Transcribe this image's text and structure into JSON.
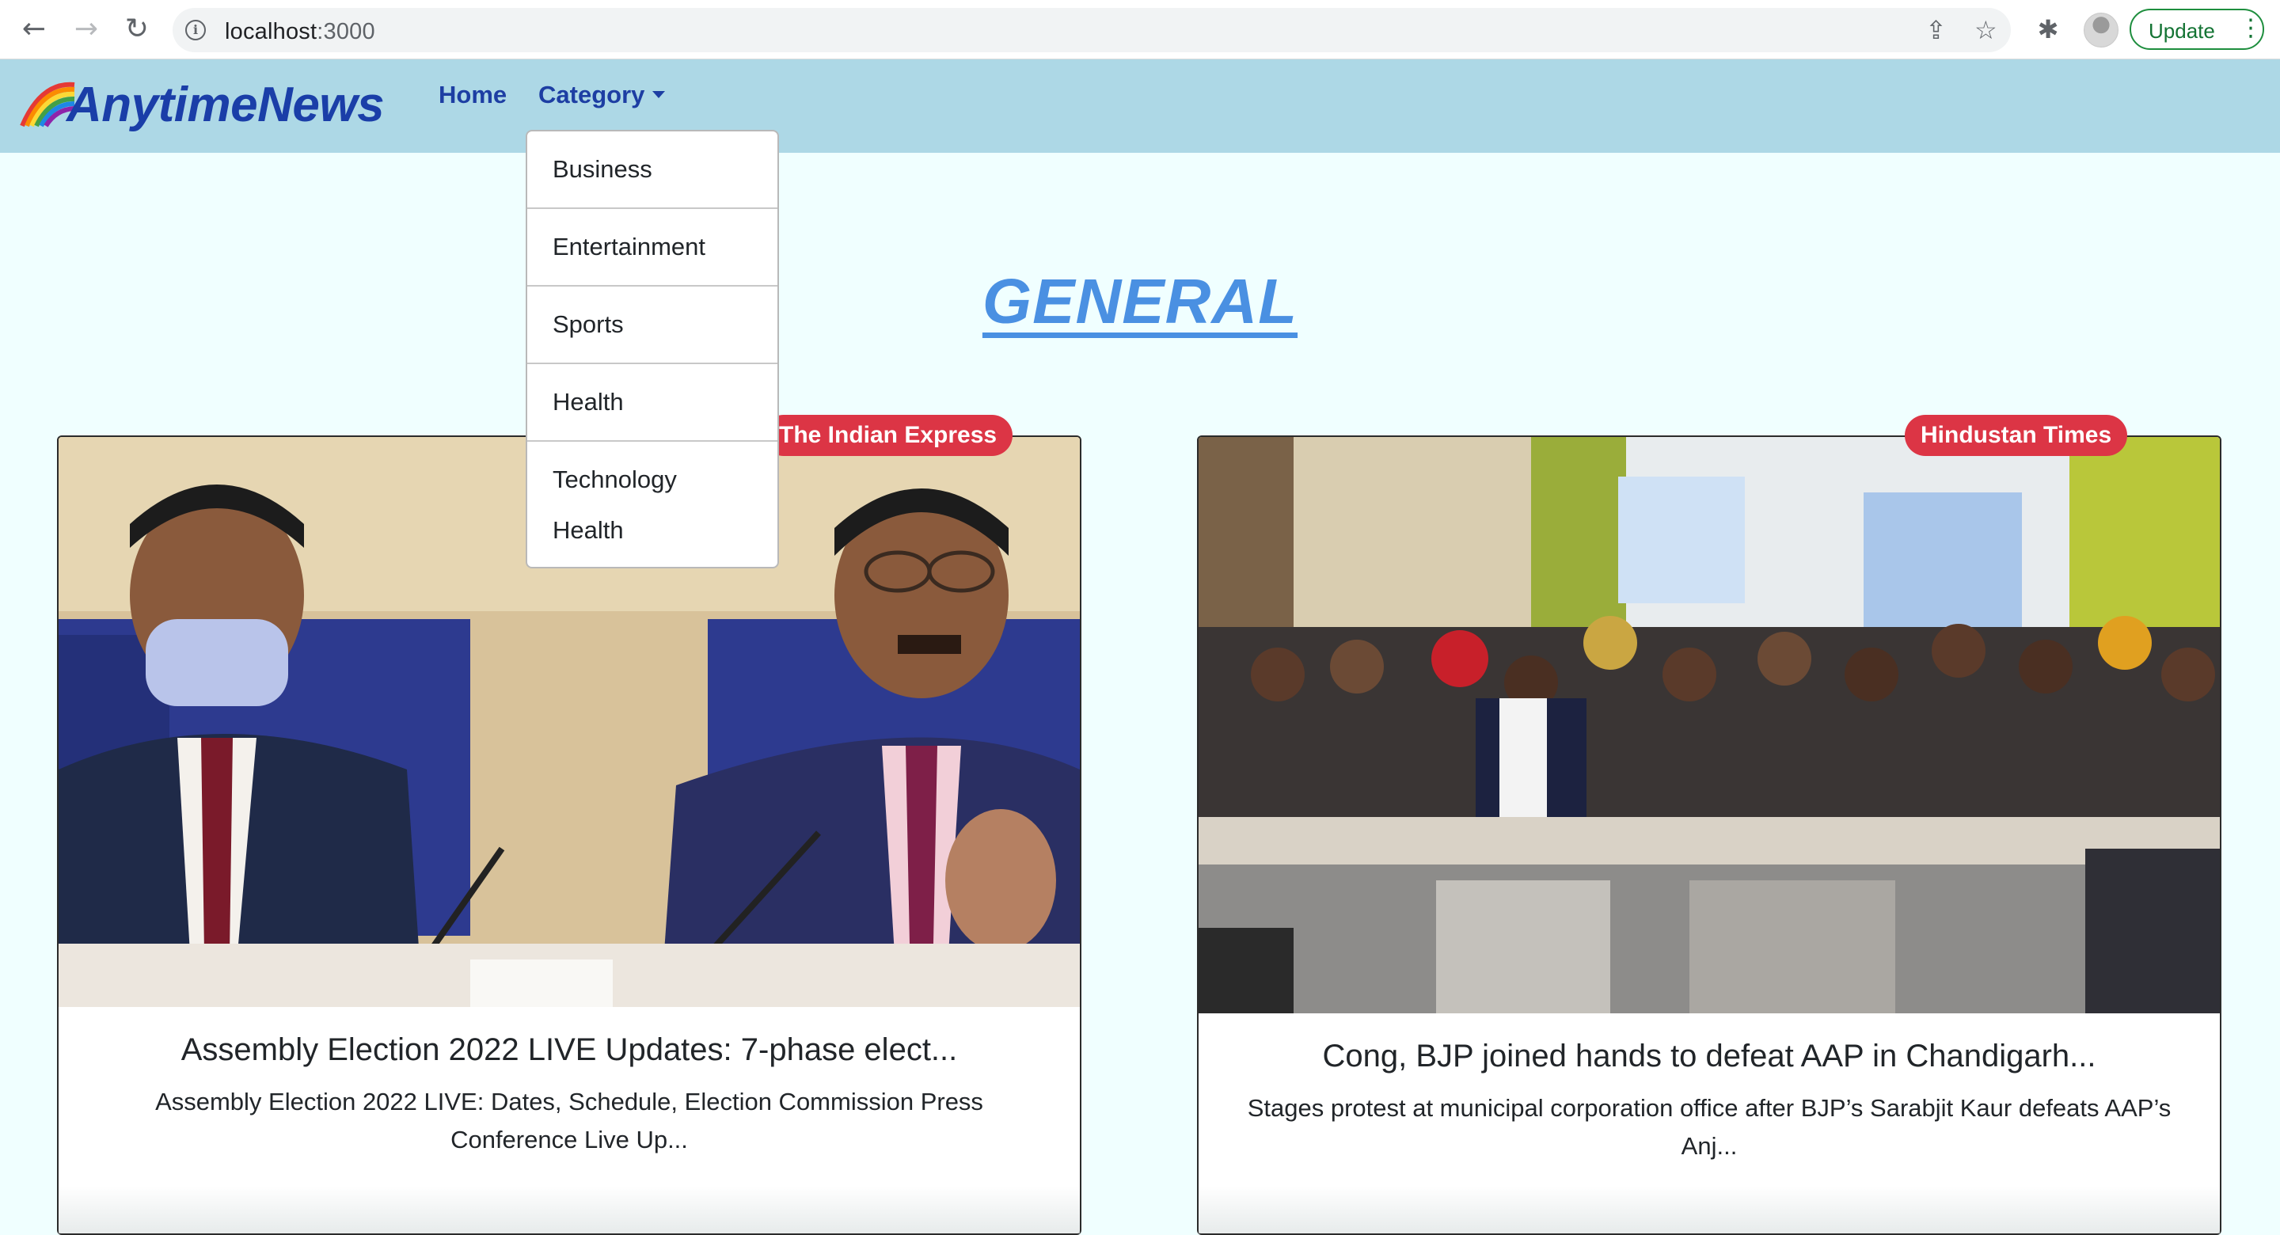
{
  "browser": {
    "url_host": "localhost",
    "url_port": ":3000",
    "update_label": "Update"
  },
  "navbar": {
    "brand": "AnytimeNews",
    "links": {
      "home": "Home",
      "category": "Category"
    }
  },
  "dropdown": {
    "items": [
      "Business",
      "Entertainment",
      "Sports",
      "Health",
      "Technology",
      "Health"
    ]
  },
  "page": {
    "heading": "GENERAL"
  },
  "articles": [
    {
      "source": "The Indian Express",
      "title": "Assembly Election 2022 LIVE Updates: 7-phase elect...",
      "description": "Assembly Election 2022 LIVE: Dates, Schedule, Election Commission Press Conference Live Up..."
    },
    {
      "source": "Hindustan Times",
      "title": "Cong, BJP joined hands to defeat AAP in Chandigarh...",
      "description": "Stages protest at municipal corporation office after BJP’s Sarabjit Kaur defeats AAP’s Anj..."
    }
  ],
  "colors": {
    "navbar_bg": "#add8e6",
    "page_bg": "#f0ffff",
    "brand": "#1a3ea8",
    "heading": "#4a90e2",
    "badge": "#dc3545",
    "update_green": "#137333"
  },
  "icons": [
    "back-arrow-icon",
    "forward-arrow-icon",
    "reload-icon",
    "info-icon",
    "share-icon",
    "star-icon",
    "extensions-icon",
    "kebab-menu-icon",
    "rainbow-logo-icon",
    "caret-down-icon"
  ]
}
